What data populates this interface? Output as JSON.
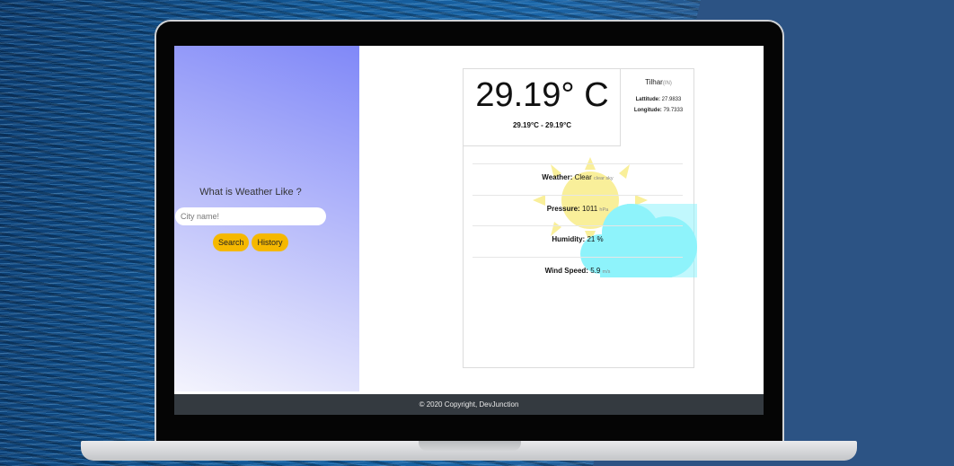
{
  "search_panel": {
    "title": "What is Weather Like ?",
    "city_placeholder": "City name!",
    "search_label": "Search",
    "history_label": "History"
  },
  "weather": {
    "temperature": "29.19° C",
    "temp_range": "29.19°C - 29.19°C",
    "city": "Tilhar",
    "country": "(IN)",
    "latitude_label": "Lattitude:",
    "latitude_value": "27.9833",
    "longitude_label": "Longitude:",
    "longitude_value": "79.7333",
    "condition_label": "Weather:",
    "condition_value": "Clear",
    "condition_detail": "clear sky",
    "pressure_label": "Pressure:",
    "pressure_value": "1011",
    "pressure_unit": "hPa",
    "humidity_label": "Humidity:",
    "humidity_value": "21 %",
    "wind_label": "Wind Speed:",
    "wind_value": "5.9",
    "wind_unit": "m/s",
    "icon": "sun-behind-cloud-icon"
  },
  "footer": {
    "copyright": "© 2020 Copyright, DevJunction"
  },
  "colors": {
    "accent_button": "#f5b800",
    "footer_bg": "#343a40",
    "panel_gradient_top": "#8088f8",
    "sun": "#f9ef9a",
    "cloud": "#8ef3fb",
    "background": "#2c5384"
  }
}
